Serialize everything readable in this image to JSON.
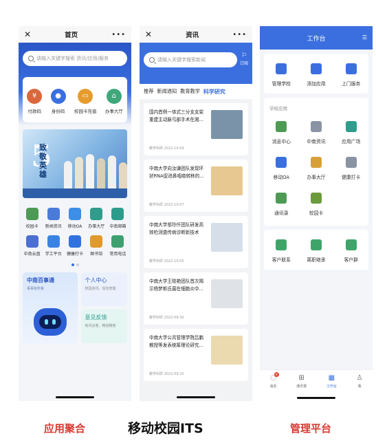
{
  "phone1": {
    "title": "首页",
    "search_placeholder": "请输入关键字搜索 资讯/应用/服务",
    "quick": [
      {
        "label": "付款码",
        "color": "#d9683c",
        "glyph": "¥"
      },
      {
        "label": "身份码",
        "color": "#3a6fe0",
        "glyph": "●"
      },
      {
        "label": "校园卡充值",
        "color": "#e69b2d",
        "glyph": "▭"
      },
      {
        "label": "办事大厅",
        "color": "#3fa77a",
        "glyph": "⌂"
      }
    ],
    "banner_num": "5",
    "banner_word": "致敬英雄",
    "apps": [
      {
        "label": "校园卡",
        "color": "#4e9a54"
      },
      {
        "label": "新闻资讯",
        "color": "#4a7bd8"
      },
      {
        "label": "移动OA",
        "color": "#3c8ee6"
      },
      {
        "label": "办事大厅",
        "color": "#2f9c8c"
      },
      {
        "label": "中南邮箱",
        "color": "#2d9b8c"
      },
      {
        "label": "中南云盘",
        "color": "#4c6fd1"
      },
      {
        "label": "学工平台",
        "color": "#3b83e2"
      },
      {
        "label": "健康打卡",
        "color": "#3172de"
      },
      {
        "label": "图书馆",
        "color": "#e09a2c"
      },
      {
        "label": "常用电话",
        "color": "#3e9f6f"
      }
    ],
    "card_big_title": "中南百事通",
    "card_big_sub": "事事有所答",
    "card_personal_title": "个人中心",
    "card_personal_sub": "校园资讯，信息管理",
    "card_feedback_title": "意见反馈",
    "card_feedback_sub": "有问必答，畅说畅答"
  },
  "phone2": {
    "title": "资讯",
    "search_placeholder": "请输入关键字搜索新闻",
    "flag_label": "订阅",
    "tabs": [
      "推荐",
      "新闻通知",
      "教育教学",
      "科学研究"
    ],
    "news": [
      {
        "title": "国内首例一体式三分支支架重建主动脉弓部手术在湘...",
        "source": "教学科研",
        "date": "2022-10-09",
        "pic": "#7a93a8"
      },
      {
        "title": "中南大学向汝谦团队发现环状RNA促进鼻咽癌转移的...",
        "source": "教学科研",
        "date": "2022-10-07",
        "pic": "#e7c890"
      },
      {
        "title": "中南大学邬玲仟团队研发高效检测遗传病诊断新技术",
        "source": "教学科研",
        "date": "2022-10-05",
        "pic": "#d6dfe9"
      },
      {
        "title": "中南大学王晓艳团队首次揭示杨梦斯氏菌在细胞炎中...",
        "source": "教学科研",
        "date": "2022-09-30",
        "pic": "#dfe3e8"
      },
      {
        "title": "中南大学公共管理学院吕鹏教授等发表统筹理论研究...",
        "source": "教学科研",
        "date": "2022-09-20",
        "pic": "#ebd9b0"
      }
    ]
  },
  "phone3": {
    "title": "工作台",
    "top_items": [
      {
        "label": "管理学校",
        "color": "#3b6fdf"
      },
      {
        "label": "添加应用",
        "color": "#3b6fdf"
      },
      {
        "label": "上门服务",
        "color": "#3b6fdf"
      }
    ],
    "section_title": "学校应用",
    "apps": [
      {
        "label": "消息中心",
        "color": "#4e9a54"
      },
      {
        "label": "中南资讯",
        "color": "#8a93a3"
      },
      {
        "label": "应用广场",
        "color": "#2f9c8c"
      },
      {
        "label": "移动OA",
        "color": "#3b6fdf"
      },
      {
        "label": "办事大厅",
        "color": "#d8a03a"
      },
      {
        "label": "健康打卡",
        "color": "#8a93a3"
      },
      {
        "label": "通讯录",
        "color": "#4e9a54"
      },
      {
        "label": "校园卡",
        "color": "#6d9a3c"
      }
    ],
    "bottom_apps": [
      {
        "label": "客户联系",
        "color": "#3ea56a"
      },
      {
        "label": "离职继承",
        "color": "#3ea56a"
      },
      {
        "label": "客户群",
        "color": "#3ea56a"
      }
    ],
    "tabbar": [
      {
        "label": "消息",
        "active": false,
        "badge": "9"
      },
      {
        "label": "通讯录",
        "active": false,
        "badge": ""
      },
      {
        "label": "工作台",
        "active": true,
        "badge": ""
      },
      {
        "label": "我",
        "active": false,
        "badge": ""
      }
    ]
  },
  "captions": {
    "left": "应用聚合",
    "center": "移动校园ITS",
    "right": "管理平台"
  }
}
